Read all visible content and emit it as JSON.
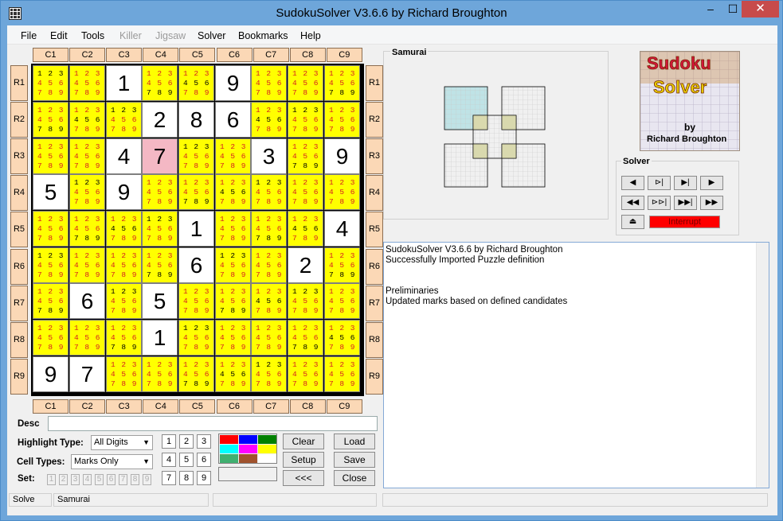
{
  "window": {
    "title": "SudokuSolver V3.6.6 by Richard Broughton",
    "minimize": "–",
    "maximize": "☐",
    "close": "✕"
  },
  "menu": [
    {
      "label": "File",
      "enabled": true
    },
    {
      "label": "Edit",
      "enabled": true
    },
    {
      "label": "Tools",
      "enabled": true
    },
    {
      "label": "Killer",
      "enabled": false
    },
    {
      "label": "Jigsaw",
      "enabled": false
    },
    {
      "label": "Solver",
      "enabled": true
    },
    {
      "label": "Bookmarks",
      "enabled": true
    },
    {
      "label": "Help",
      "enabled": true
    }
  ],
  "columns": [
    "C1",
    "C2",
    "C3",
    "C4",
    "C5",
    "C6",
    "C7",
    "C8",
    "C9"
  ],
  "rows": [
    "R1",
    "R2",
    "R3",
    "R4",
    "R5",
    "R6",
    "R7",
    "R8",
    "R9"
  ],
  "grid": [
    [
      "m",
      "m",
      "1",
      "m",
      "m",
      "9",
      "m",
      "m",
      "m"
    ],
    [
      "m",
      "m",
      "m",
      "2",
      "8",
      "6",
      "m",
      "m",
      "m"
    ],
    [
      "m",
      "m",
      "4",
      "7",
      "m",
      "m",
      "3",
      "m",
      "9"
    ],
    [
      "5",
      "m",
      "9",
      "m",
      "m",
      "m",
      "m",
      "m",
      "m"
    ],
    [
      "m",
      "m",
      "m",
      "m",
      "1",
      "m",
      "m",
      "m",
      "4"
    ],
    [
      "m",
      "m",
      "m",
      "m",
      "6",
      "m",
      "m",
      "2",
      "m"
    ],
    [
      "m",
      "6",
      "m",
      "5",
      "m",
      "m",
      "m",
      "m",
      "m"
    ],
    [
      "m",
      "m",
      "m",
      "1",
      "m",
      "m",
      "m",
      "m",
      "m"
    ],
    [
      "9",
      "7",
      "m",
      "m",
      "m",
      "m",
      "m",
      "m",
      "m"
    ]
  ],
  "highlight_cell": {
    "row": 3,
    "col": 4,
    "color": "#f4b8c4"
  },
  "mark_rows": [
    "1 2 3",
    "4 5 6",
    "7 8 9"
  ],
  "samurai": {
    "label": "Samurai"
  },
  "logo": {
    "line1": "Sudoku",
    "line2": "Solver",
    "line3": "by",
    "line4": "Richard Broughton"
  },
  "solver": {
    "label": "Solver",
    "interrupt": "Interrupt",
    "buttons": [
      "◀",
      "⊳|",
      "▶|",
      "▶",
      "◀◀",
      "⊳⊳|",
      "▶▶|",
      "▶▶",
      "⏏"
    ]
  },
  "log": [
    "SudokuSolver V3.6.6 by Richard Broughton",
    "Successfully Imported Puzzle definition",
    "",
    "",
    "Preliminaries",
    "Updated marks based on defined candidates"
  ],
  "desc": {
    "label": "Desc",
    "value": ""
  },
  "highlight": {
    "label": "Highlight Type:",
    "value": "All Digits"
  },
  "celltypes": {
    "label": "Cell Types:",
    "value": "Marks Only"
  },
  "set": {
    "label": "Set:",
    "values": [
      "1",
      "2",
      "3",
      "4",
      "5",
      "6",
      "7",
      "8",
      "9"
    ]
  },
  "numpad": [
    "1",
    "2",
    "3",
    "4",
    "5",
    "6",
    "7",
    "8",
    "9"
  ],
  "palette": [
    "#ff0000",
    "#0000ff",
    "#008000",
    "#00ffff",
    "#ff00ff",
    "#ffff00",
    "#40b070",
    "#a0522d",
    "#ffffff"
  ],
  "buttons": {
    "clear": "Clear",
    "load": "Load",
    "setup": "Setup",
    "save": "Save",
    "back": "<<<",
    "close": "Close"
  },
  "status": {
    "mode": "Solve",
    "puzzle": "Samurai",
    "p3": "",
    "p4": ""
  }
}
